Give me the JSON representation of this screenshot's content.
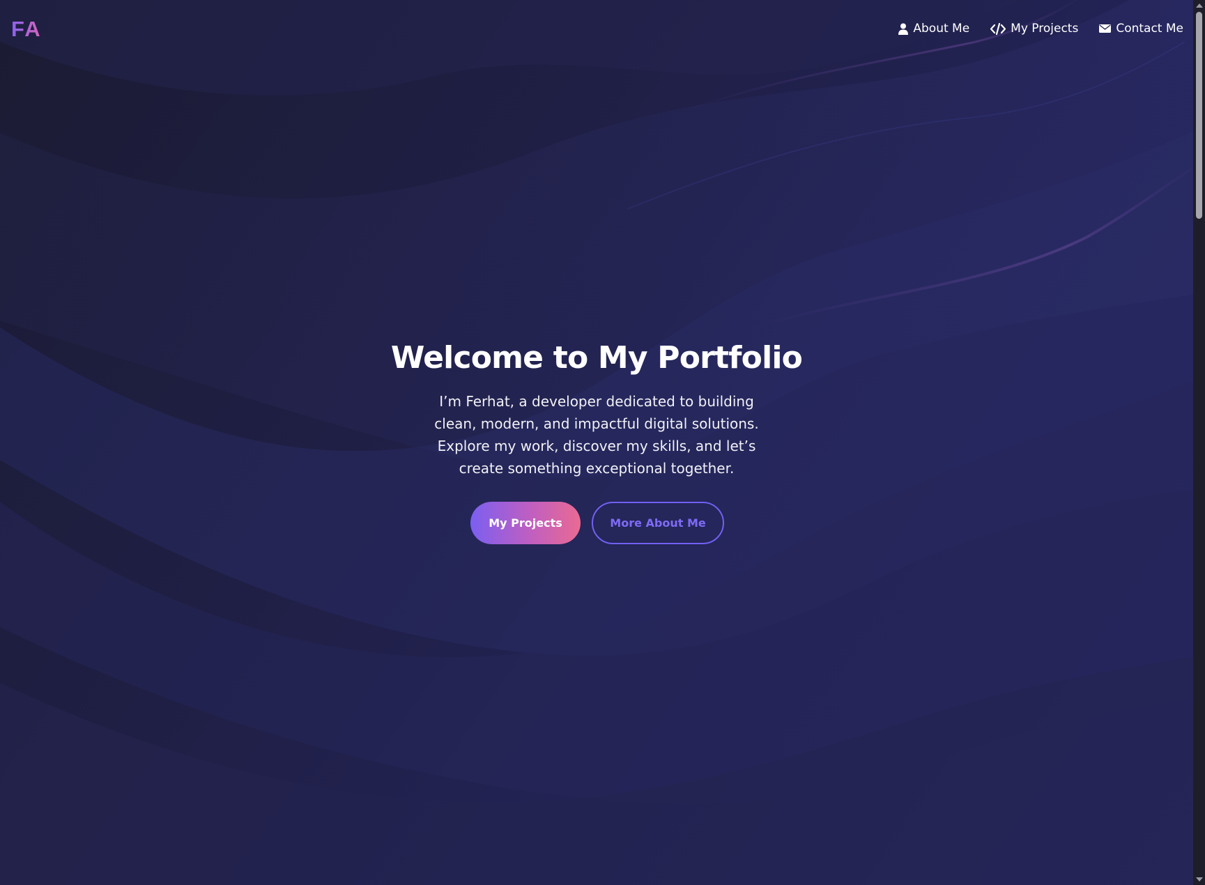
{
  "logo": {
    "text": "FA"
  },
  "nav": {
    "items": [
      {
        "label": "About Me",
        "icon": "user-icon"
      },
      {
        "label": "My Projects",
        "icon": "code-icon"
      },
      {
        "label": "Contact Me",
        "icon": "envelope-icon"
      }
    ]
  },
  "hero": {
    "title": "Welcome to My Portfolio",
    "subtitle": "I’m Ferhat, a developer dedicated to building clean, modern, and impactful digital solutions. Explore my work, discover my skills, and let’s create something exceptional together.",
    "primary_button": "My Projects",
    "secondary_button": "More About Me"
  },
  "colors": {
    "background": "#1f1f45",
    "accent_purple": "#7b5ff1",
    "accent_pink": "#ea6a92",
    "outline": "#7160f2"
  }
}
